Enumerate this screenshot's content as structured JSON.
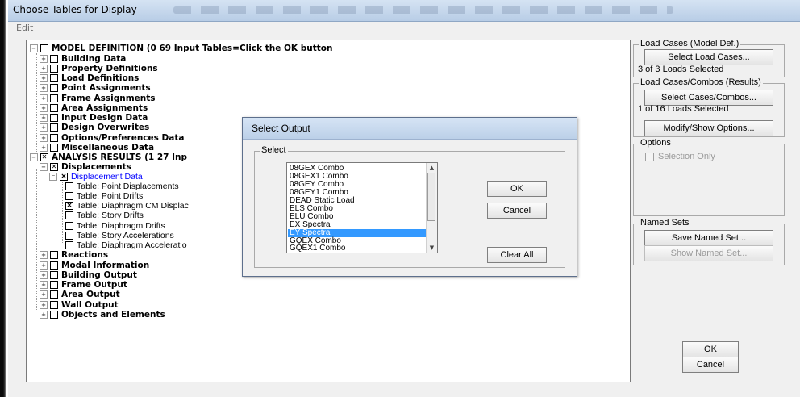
{
  "window": {
    "title": "Choose Tables for Display"
  },
  "menu": {
    "edit": "Edit"
  },
  "tree": {
    "model": "MODEL DEFINITION  (0  69 Input Tables=Click the OK button",
    "model_children": [
      "Building Data",
      "Property Definitions",
      "Load Definitions",
      "Point Assignments",
      "Frame Assignments",
      "Area Assignments",
      "Input Design Data",
      "Design Overwrites",
      "Options/Preferences Data",
      "Miscellaneous Data"
    ],
    "analysis": "ANALYSIS RESULTS  (1  27 Inp",
    "displacements": "Displacements",
    "displacement_data": "Displacement Data",
    "tables": [
      "Table:  Point Displacements",
      "Table:  Point Drifts",
      "Table:  Diaphragm CM Displac",
      "Table:  Story Drifts",
      "Table:  Diaphragm Drifts",
      "Table:  Story Accelerations",
      "Table:  Diaphragm Acceleratio"
    ],
    "analysis_children": [
      "Reactions",
      "Modal Information",
      "Building Output",
      "Frame Output",
      "Area Output",
      "Wall Output",
      "Objects and Elements"
    ]
  },
  "right_panel": {
    "load_cases_title": "Load Cases (Model Def.)",
    "select_load_cases": "Select Load Cases...",
    "load_cases_status": "3  of  3  Loads Selected",
    "results_title": "Load Cases/Combos (Results)",
    "select_cases_combos": "Select Cases/Combos...",
    "results_status": "1  of  16  Loads Selected",
    "modify_show": "Modify/Show Options...",
    "options_title": "Options",
    "selection_only": "Selection Only",
    "named_sets_title": "Named Sets",
    "save_named_set": "Save Named Set...",
    "show_named_set": "Show Named Set...",
    "ok": "OK",
    "cancel": "Cancel"
  },
  "dialog": {
    "title": "Select Output",
    "group": "Select",
    "items": [
      "08GEX Combo",
      "08GEX1 Combo",
      "08GEY Combo",
      "08GEY1 Combo",
      "DEAD Static Load",
      "ELS Combo",
      "ELU Combo",
      "EX Spectra",
      "EY Spectra",
      "GQEX Combo",
      "GQEX1 Combo"
    ],
    "selected_item": "EY Spectra",
    "ok": "OK",
    "cancel": "Cancel",
    "clear_all": "Clear All"
  },
  "colors": {
    "selection": "#3399ff",
    "tree_selected_text": "#0000ff"
  }
}
